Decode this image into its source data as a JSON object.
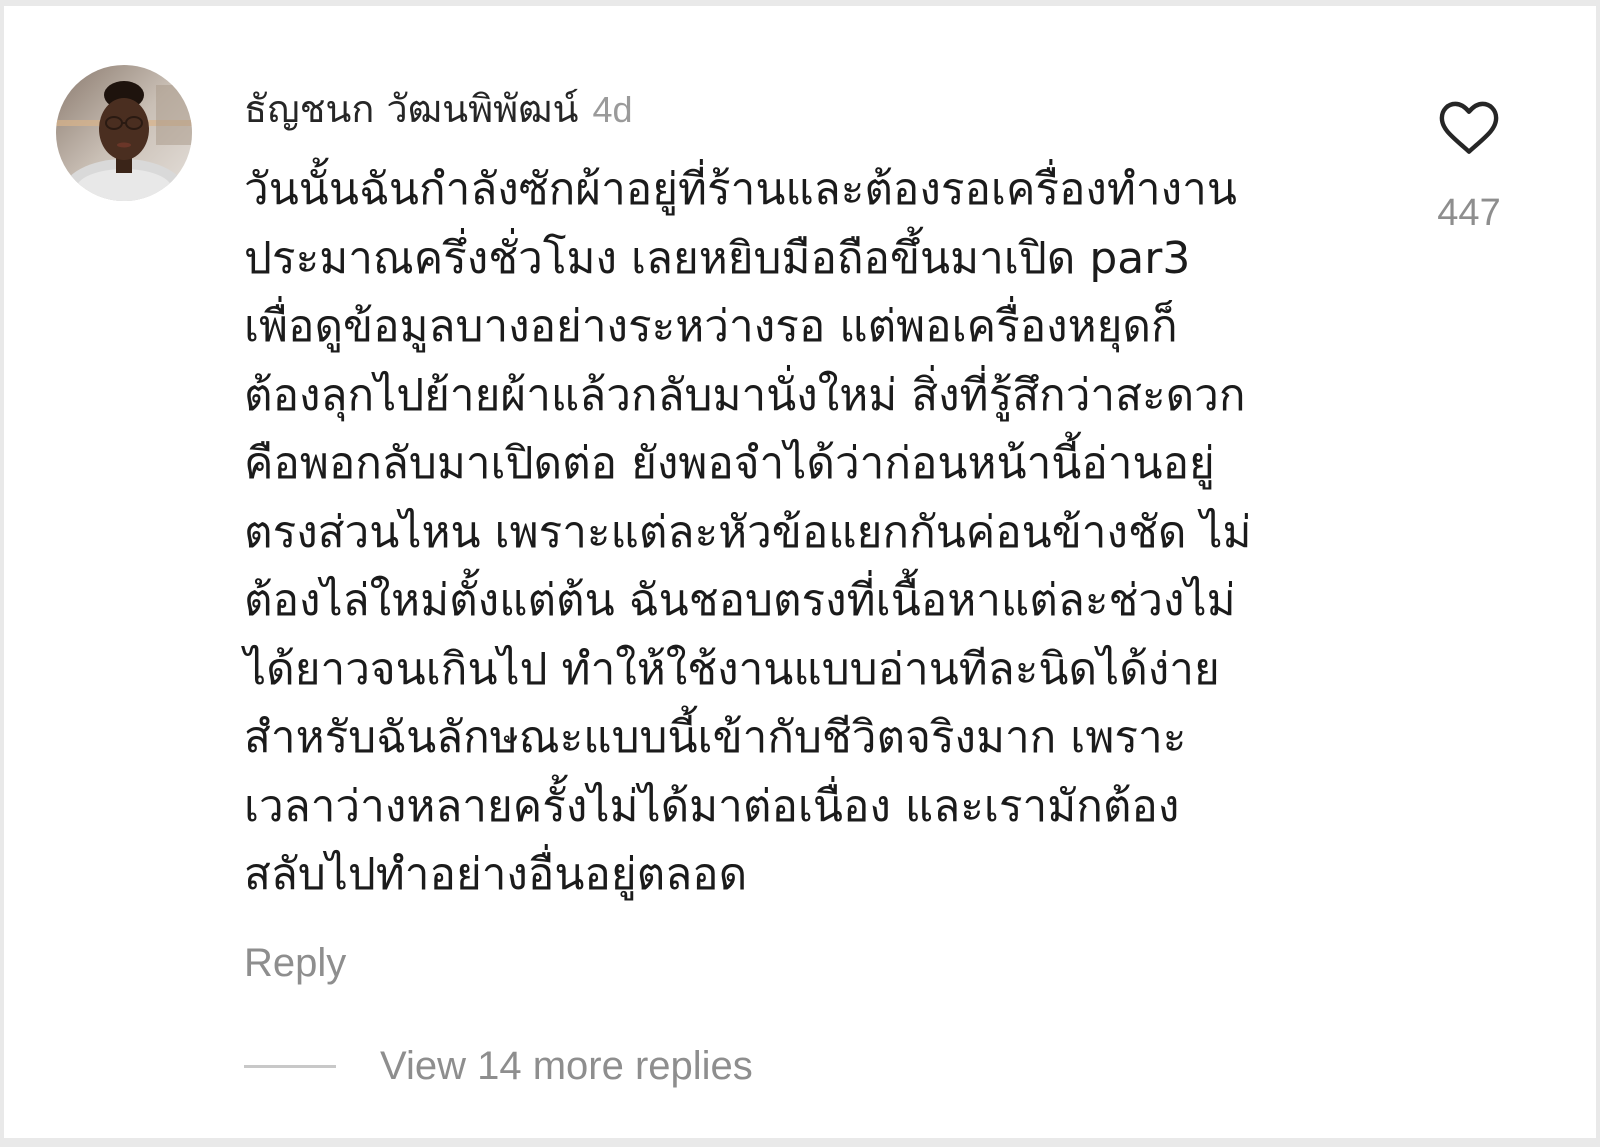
{
  "comment": {
    "username": "ธัญชนก วัฒนพิพัฒน์",
    "time": "4d",
    "text": "วันนั้นฉันกำลังซักผ้าอยู่ที่ร้านและต้องรอเครื่องทำงาน\nประมาณครึ่งชั่วโมง เลยหยิบมือถือขึ้นมาเปิด par3\nเพื่อดูข้อมูลบางอย่างระหว่างรอ แต่พอเครื่องหยุดก็\nต้องลุกไปย้ายผ้าแล้วกลับมานั่งใหม่ สิ่งที่รู้สึกว่าสะดวก\nคือพอกลับมาเปิดต่อ ยังพอจำได้ว่าก่อนหน้านี้อ่านอยู่\nตรงส่วนไหน เพราะแต่ละหัวข้อแยกกันค่อนข้างชัด ไม่\nต้องไล่ใหม่ตั้งแต่ต้น ฉันชอบตรงที่เนื้อหาแต่ละช่วงไม่\nได้ยาวจนเกินไป ทำให้ใช้งานแบบอ่านทีละนิดได้ง่าย\nสำหรับฉันลักษณะแบบนี้เข้ากับชีวิตจริงมาก เพราะ\nเวลาว่างหลายครั้งไม่ได้มาต่อเนื่อง และเรามักต้อง\nสลับไปทำอย่างอื่นอยู่ตลอด",
    "like_count": "447",
    "like_icon": "heart-outline-icon",
    "reply_label": "Reply",
    "view_replies_label": "View 14 more replies"
  },
  "colors": {
    "text_primary": "#1b1b1b",
    "text_secondary": "#8e8e8e",
    "background": "#ffffff"
  }
}
